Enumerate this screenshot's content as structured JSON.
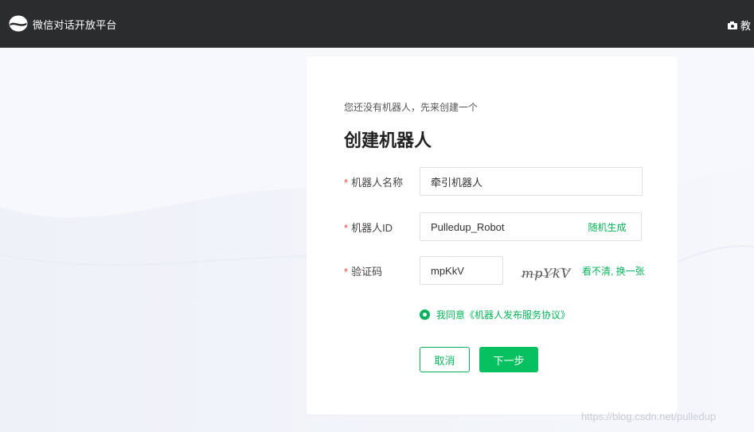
{
  "header": {
    "brand": "微信对话开放平台",
    "right_label": "教",
    "icons": {
      "logo": "wechat-dialog-logo",
      "right": "camera-icon"
    }
  },
  "form": {
    "hint": "您还没有机器人，先来创建一个",
    "title": "创建机器人",
    "name": {
      "star": "*",
      "label": "机器人名称",
      "value": "牵引机器人"
    },
    "id": {
      "star": "*",
      "label": "机器人ID",
      "value": "Pulledup_Robot",
      "generate_label": "随机生成"
    },
    "captcha": {
      "star": "*",
      "label": "验证码",
      "value": "mpKkV",
      "image_text": "mpYkV",
      "refresh_label": "看不清, 换一张"
    },
    "agree_label": "我同意《机器人发布服务协议》",
    "cancel_label": "取消",
    "next_label": "下一步"
  },
  "watermark": "https://blog.csdn.net/pulledup",
  "colors": {
    "accent": "#07c160",
    "accent_text": "#07b35a",
    "header_bg": "#2b2c2e",
    "required": "#e84b4b"
  }
}
